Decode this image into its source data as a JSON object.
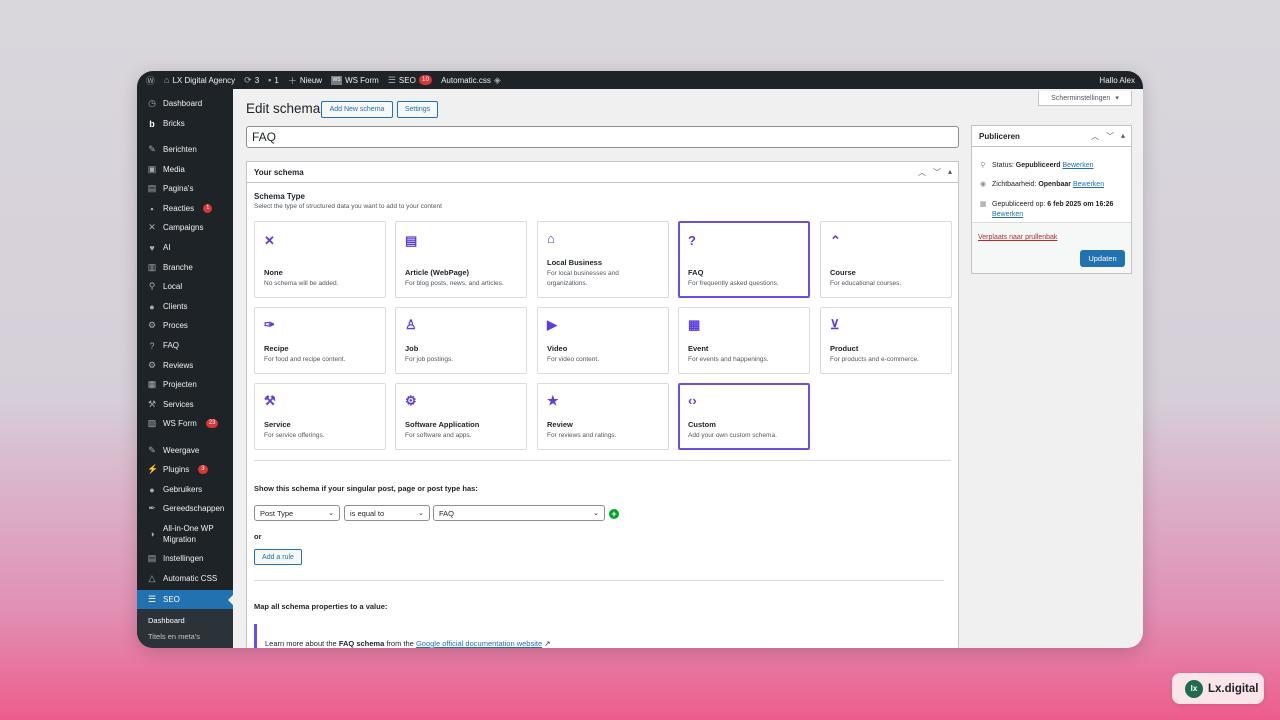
{
  "admin_bar": {
    "site_name": "LX Digital Agency",
    "updates_count": "3",
    "comments_count": "1",
    "new_label": "Nieuw",
    "wsform_label": "WS Form",
    "seo_label": "SEO",
    "seo_badge": "10",
    "automatic_css_label": "Automatic.css",
    "greeting": "Hallo Alex"
  },
  "sidebar": {
    "items": [
      {
        "label": "Dashboard",
        "icon": "dashboard-icon"
      },
      {
        "label": "Bricks",
        "icon": "bricks-icon"
      },
      {
        "label": "Berichten",
        "icon": "pin-icon"
      },
      {
        "label": "Media",
        "icon": "media-icon"
      },
      {
        "label": "Pagina's",
        "icon": "pages-icon"
      },
      {
        "label": "Reacties",
        "icon": "comments-icon",
        "badge": "1"
      },
      {
        "label": "Campaigns",
        "icon": "campaigns-icon"
      },
      {
        "label": "AI",
        "icon": "ai-icon"
      },
      {
        "label": "Branche",
        "icon": "branche-icon"
      },
      {
        "label": "Local",
        "icon": "location-icon"
      },
      {
        "label": "Clients",
        "icon": "clients-icon"
      },
      {
        "label": "Proces",
        "icon": "gear-icon"
      },
      {
        "label": "FAQ",
        "icon": "faq-icon"
      },
      {
        "label": "Reviews",
        "icon": "gear-icon"
      },
      {
        "label": "Projecten",
        "icon": "projects-icon"
      },
      {
        "label": "Services",
        "icon": "hammer-icon"
      },
      {
        "label": "WS Form",
        "icon": "wsform-icon",
        "badge": "23"
      },
      {
        "label": "Weergave",
        "icon": "appearance-icon"
      },
      {
        "label": "Plugins",
        "icon": "plugins-icon",
        "badge": "3"
      },
      {
        "label": "Gebruikers",
        "icon": "users-icon"
      },
      {
        "label": "Gereedschappen",
        "icon": "tools-icon"
      },
      {
        "label": "All-in-One WP Migration",
        "icon": "migration-icon"
      },
      {
        "label": "Instellingen",
        "icon": "settings-icon"
      },
      {
        "label": "Automatic CSS",
        "icon": "acss-icon"
      },
      {
        "label": "SEO",
        "icon": "seo-icon"
      }
    ],
    "submenu": [
      "Dashboard",
      "Titels en meta's"
    ]
  },
  "screen_options": "Scherminstellingen",
  "page": {
    "title": "Edit schema",
    "add_new_label": "Add New schema",
    "settings_label": "Settings",
    "post_title": "FAQ"
  },
  "schema_box": {
    "title": "Your schema",
    "type_heading": "Schema Type",
    "type_desc": "Select the type of structured data you want to add to your content",
    "cards": [
      {
        "title": "None",
        "desc": "No schema will be added.",
        "icon": "close-icon"
      },
      {
        "title": "Article (WebPage)",
        "desc": "For blog posts, news, and articles.",
        "icon": "document-icon"
      },
      {
        "title": "Local Business",
        "desc": "For local businesses and organizations.",
        "icon": "store-icon"
      },
      {
        "title": "FAQ",
        "desc": "For frequently asked questions.",
        "icon": "question-icon",
        "selected": true
      },
      {
        "title": "Course",
        "desc": "For educational courses.",
        "icon": "graduation-cap-icon"
      },
      {
        "title": "Recipe",
        "desc": "For food and recipe content.",
        "icon": "carrot-icon"
      },
      {
        "title": "Job",
        "desc": "For job postings.",
        "icon": "person-icon"
      },
      {
        "title": "Video",
        "desc": "For video content.",
        "icon": "video-icon"
      },
      {
        "title": "Event",
        "desc": "For events and happenings.",
        "icon": "calendar-icon"
      },
      {
        "title": "Product",
        "desc": "For products and e-commerce.",
        "icon": "cart-icon"
      },
      {
        "title": "Service",
        "desc": "For service offerings.",
        "icon": "hammer-icon"
      },
      {
        "title": "Software Application",
        "desc": "For software and apps.",
        "icon": "gear-icon"
      },
      {
        "title": "Review",
        "desc": "For reviews and ratings.",
        "icon": "star-icon"
      },
      {
        "title": "Custom",
        "desc": "Add your own custom schema.",
        "icon": "code-icon",
        "selected": true
      }
    ],
    "rule_heading": "Show this schema if your singular post, page or post type has:",
    "rule": {
      "field": "Post Type",
      "operator": "is equal to",
      "value": "FAQ"
    },
    "or_label": "or",
    "add_rule_label": "Add a rule",
    "map_heading": "Map all schema properties to a value:",
    "notice": {
      "prefix": "Learn more about the",
      "schema_name": "FAQ schema",
      "middle": "from the",
      "link_text": "Google official documentation website"
    }
  },
  "publish_box": {
    "title": "Publiceren",
    "status_label": "Status:",
    "status_value": "Gepubliceerd",
    "visibility_label": "Zichtbaarheid:",
    "visibility_value": "Openbaar",
    "published_label": "Gepubliceerd op:",
    "published_value": "6 feb 2025 om",
    "published_time": "16:26",
    "edit_label": "Bewerken",
    "trash_label": "Verplaats naar prullenbak",
    "update_label": "Updaten"
  },
  "watermark": {
    "logo_text": "lx",
    "text": "Lx.digital"
  },
  "colors": {
    "accent": "#2271b1",
    "schema_accent": "#6b4ee6",
    "admin_dark": "#1d2327",
    "danger": "#d63638"
  }
}
